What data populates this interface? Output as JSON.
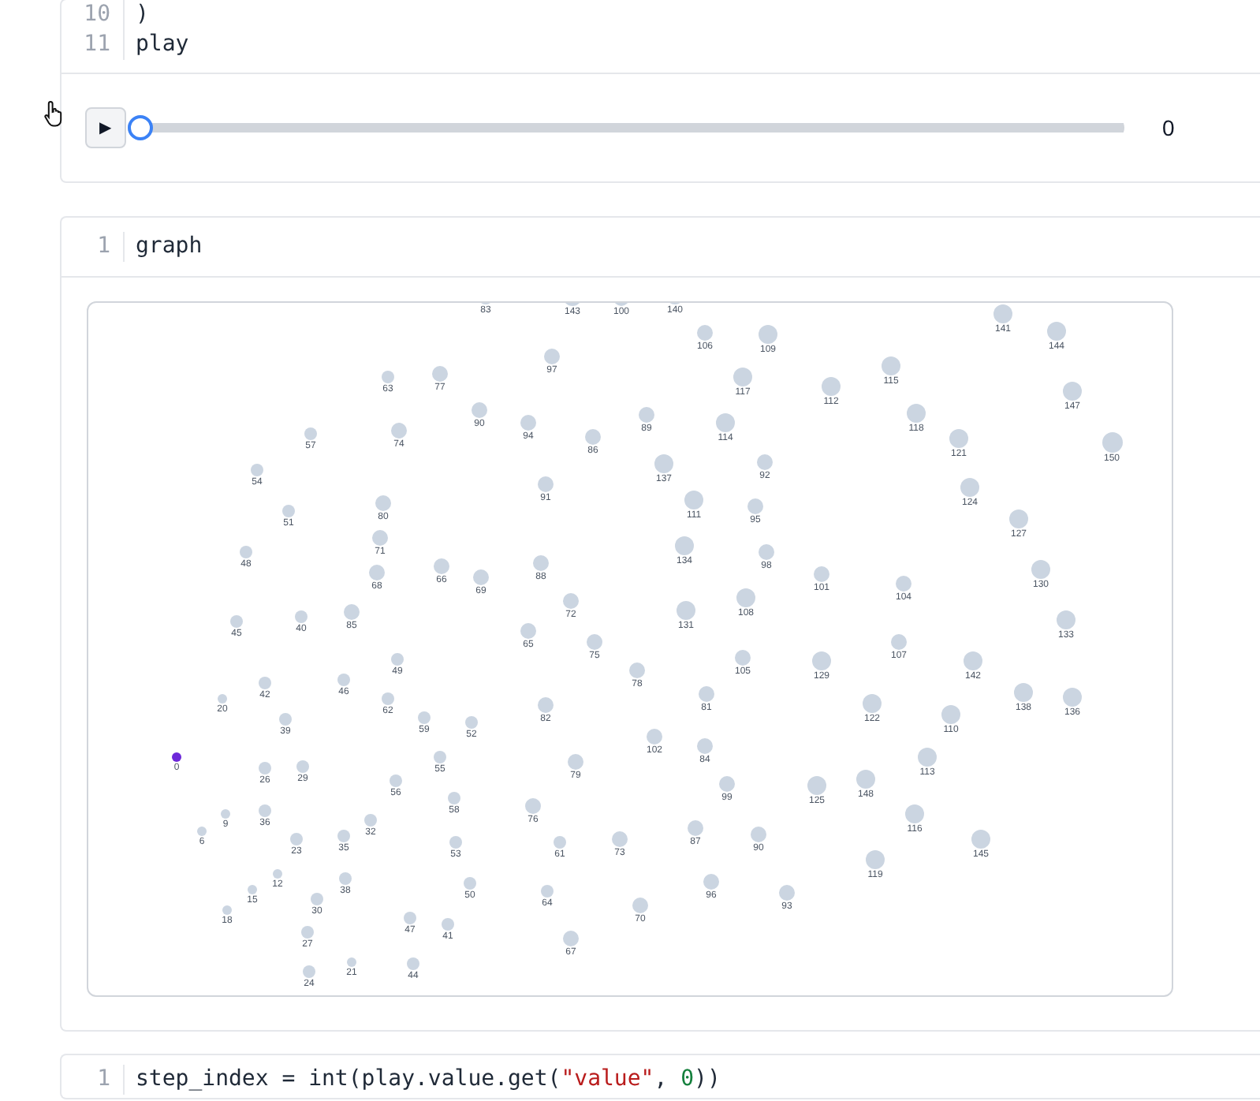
{
  "cells": [
    {
      "lines": [
        {
          "number": "10",
          "tokens": [
            {
              "text": ")",
              "kind": "plain"
            }
          ]
        },
        {
          "number": "11",
          "tokens": [
            {
              "text": "play",
              "kind": "plain"
            }
          ]
        }
      ],
      "output": {
        "kind": "player",
        "play_icon": "▶",
        "slider": {
          "level": 0
        },
        "reading": "0"
      }
    },
    {
      "lines": [
        {
          "number": "1",
          "tokens": [
            {
              "text": "graph",
              "kind": "plain"
            }
          ]
        }
      ],
      "output": {
        "kind": "graph",
        "nodes": [
          {
            "label": "83",
            "active": false
          },
          {
            "label": "143",
            "active": false
          },
          {
            "label": "100",
            "active": false
          },
          {
            "label": "140",
            "active": false
          },
          {
            "label": "141",
            "active": false
          },
          {
            "label": "106",
            "active": false
          },
          {
            "label": "109",
            "active": false
          },
          {
            "label": "144",
            "active": false
          },
          {
            "label": "97",
            "active": false
          },
          {
            "label": "115",
            "active": false
          },
          {
            "label": "63",
            "active": false
          },
          {
            "label": "77",
            "active": false
          },
          {
            "label": "117",
            "active": false
          },
          {
            "label": "112",
            "active": false
          },
          {
            "label": "147",
            "active": false
          },
          {
            "label": "90",
            "active": false
          },
          {
            "label": "94",
            "active": false
          },
          {
            "label": "89",
            "active": false
          },
          {
            "label": "114",
            "active": false
          },
          {
            "label": "118",
            "active": false
          },
          {
            "label": "57",
            "active": false
          },
          {
            "label": "74",
            "active": false
          },
          {
            "label": "86",
            "active": false
          },
          {
            "label": "121",
            "active": false
          },
          {
            "label": "150",
            "active": false
          },
          {
            "label": "54",
            "active": false
          },
          {
            "label": "137",
            "active": false
          },
          {
            "label": "92",
            "active": false
          },
          {
            "label": "91",
            "active": false
          },
          {
            "label": "111",
            "active": false
          },
          {
            "label": "124",
            "active": false
          },
          {
            "label": "51",
            "active": false
          },
          {
            "label": "80",
            "active": false
          },
          {
            "label": "95",
            "active": false
          },
          {
            "label": "127",
            "active": false
          },
          {
            "label": "48",
            "active": false
          },
          {
            "label": "71",
            "active": false
          },
          {
            "label": "134",
            "active": false
          },
          {
            "label": "98",
            "active": false
          },
          {
            "label": "68",
            "active": false
          },
          {
            "label": "66",
            "active": false
          },
          {
            "label": "69",
            "active": false
          },
          {
            "label": "88",
            "active": false
          },
          {
            "label": "101",
            "active": false
          },
          {
            "label": "130",
            "active": false
          },
          {
            "label": "108",
            "active": false
          },
          {
            "label": "104",
            "active": false
          },
          {
            "label": "40",
            "active": false
          },
          {
            "label": "85",
            "active": false
          },
          {
            "label": "72",
            "active": false
          },
          {
            "label": "131",
            "active": false
          },
          {
            "label": "45",
            "active": false
          },
          {
            "label": "65",
            "active": false
          },
          {
            "label": "133",
            "active": false
          },
          {
            "label": "75",
            "active": false
          },
          {
            "label": "105",
            "active": false
          },
          {
            "label": "107",
            "active": false
          },
          {
            "label": "49",
            "active": false
          },
          {
            "label": "78",
            "active": false
          },
          {
            "label": "129",
            "active": false
          },
          {
            "label": "142",
            "active": false
          },
          {
            "label": "20",
            "active": false
          },
          {
            "label": "42",
            "active": false
          },
          {
            "label": "46",
            "active": false
          },
          {
            "label": "62",
            "active": false
          },
          {
            "label": "82",
            "active": false
          },
          {
            "label": "81",
            "active": false
          },
          {
            "label": "122",
            "active": false
          },
          {
            "label": "138",
            "active": false
          },
          {
            "label": "136",
            "active": false
          },
          {
            "label": "39",
            "active": false
          },
          {
            "label": "59",
            "active": false
          },
          {
            "label": "52",
            "active": false
          },
          {
            "label": "110",
            "active": false
          },
          {
            "label": "102",
            "active": false
          },
          {
            "label": "84",
            "active": false
          },
          {
            "label": "0",
            "active": true
          },
          {
            "label": "26",
            "active": false
          },
          {
            "label": "29",
            "active": false
          },
          {
            "label": "55",
            "active": false
          },
          {
            "label": "79",
            "active": false
          },
          {
            "label": "113",
            "active": false
          },
          {
            "label": "56",
            "active": false
          },
          {
            "label": "99",
            "active": false
          },
          {
            "label": "125",
            "active": false
          },
          {
            "label": "148",
            "active": false
          },
          {
            "label": "9",
            "active": false
          },
          {
            "label": "36",
            "active": false
          },
          {
            "label": "58",
            "active": false
          },
          {
            "label": "76",
            "active": false
          },
          {
            "label": "116",
            "active": false
          },
          {
            "label": "6",
            "active": false
          },
          {
            "label": "35",
            "active": false
          },
          {
            "label": "32",
            "active": false
          },
          {
            "label": "87",
            "active": false
          },
          {
            "label": "90",
            "active": false
          },
          {
            "label": "23",
            "active": false
          },
          {
            "label": "53",
            "active": false
          },
          {
            "label": "61",
            "active": false
          },
          {
            "label": "73",
            "active": false
          },
          {
            "label": "145",
            "active": false
          },
          {
            "label": "12",
            "active": false
          },
          {
            "label": "119",
            "active": false
          },
          {
            "label": "15",
            "active": false
          },
          {
            "label": "38",
            "active": false
          },
          {
            "label": "50",
            "active": false
          },
          {
            "label": "64",
            "active": false
          },
          {
            "label": "96",
            "active": false
          },
          {
            "label": "93",
            "active": false
          },
          {
            "label": "18",
            "active": false
          },
          {
            "label": "30",
            "active": false
          },
          {
            "label": "70",
            "active": false
          },
          {
            "label": "27",
            "active": false
          },
          {
            "label": "47",
            "active": false
          },
          {
            "label": "41",
            "active": false
          },
          {
            "label": "67",
            "active": false
          },
          {
            "label": "24",
            "active": false
          },
          {
            "label": "21",
            "active": false
          },
          {
            "label": "44",
            "active": false
          }
        ]
      }
    },
    {
      "lines": [
        {
          "number": "1",
          "tokens": [
            {
              "text": "step_index = int(play.value.get(",
              "kind": "plain"
            },
            {
              "text": "\"value\"",
              "kind": "string"
            },
            {
              "text": ", ",
              "kind": "plain"
            },
            {
              "text": "0",
              "kind": "number"
            },
            {
              "text": "))",
              "kind": "plain"
            }
          ]
        }
      ]
    }
  ]
}
